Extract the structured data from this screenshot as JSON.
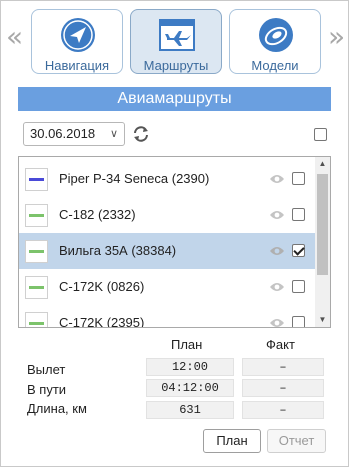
{
  "nav": {
    "prev_arrow": "«",
    "next_arrow": "»",
    "tabs": [
      {
        "label": "Навигация",
        "icon": "compass-plane-icon"
      },
      {
        "label": "Маршруты",
        "icon": "airplane-window-icon",
        "active": true
      },
      {
        "label": "Модели",
        "icon": "model-shape-icon"
      }
    ]
  },
  "section_title": "Авиамаршруты",
  "date_filter": {
    "value": "30.06.2018"
  },
  "routes": [
    {
      "name": "Piper P-34 Seneca (2390)",
      "color": "#4a4ad8",
      "checked": false,
      "selected": false
    },
    {
      "name": "C-182 (2332)",
      "color": "#7cc36b",
      "checked": false,
      "selected": false
    },
    {
      "name": "Вильга 35А (38384)",
      "color": "#7cc36b",
      "checked": true,
      "selected": true
    },
    {
      "name": "C-172K (0826)",
      "color": "#7cc36b",
      "checked": false,
      "selected": false
    },
    {
      "name": "C-172K (2395)",
      "color": "#7cc36b",
      "checked": false,
      "selected": false
    }
  ],
  "summary": {
    "col_plan": "План",
    "col_fact": "Факт",
    "rows": [
      {
        "label": "Вылет",
        "plan": "12:00",
        "fact": "–"
      },
      {
        "label": "В пути",
        "plan": "04:12:00",
        "fact": "–"
      },
      {
        "label": "Длина, км",
        "plan": "631",
        "fact": "–"
      }
    ]
  },
  "buttons": {
    "plan": "План",
    "report": "Отчет"
  }
}
